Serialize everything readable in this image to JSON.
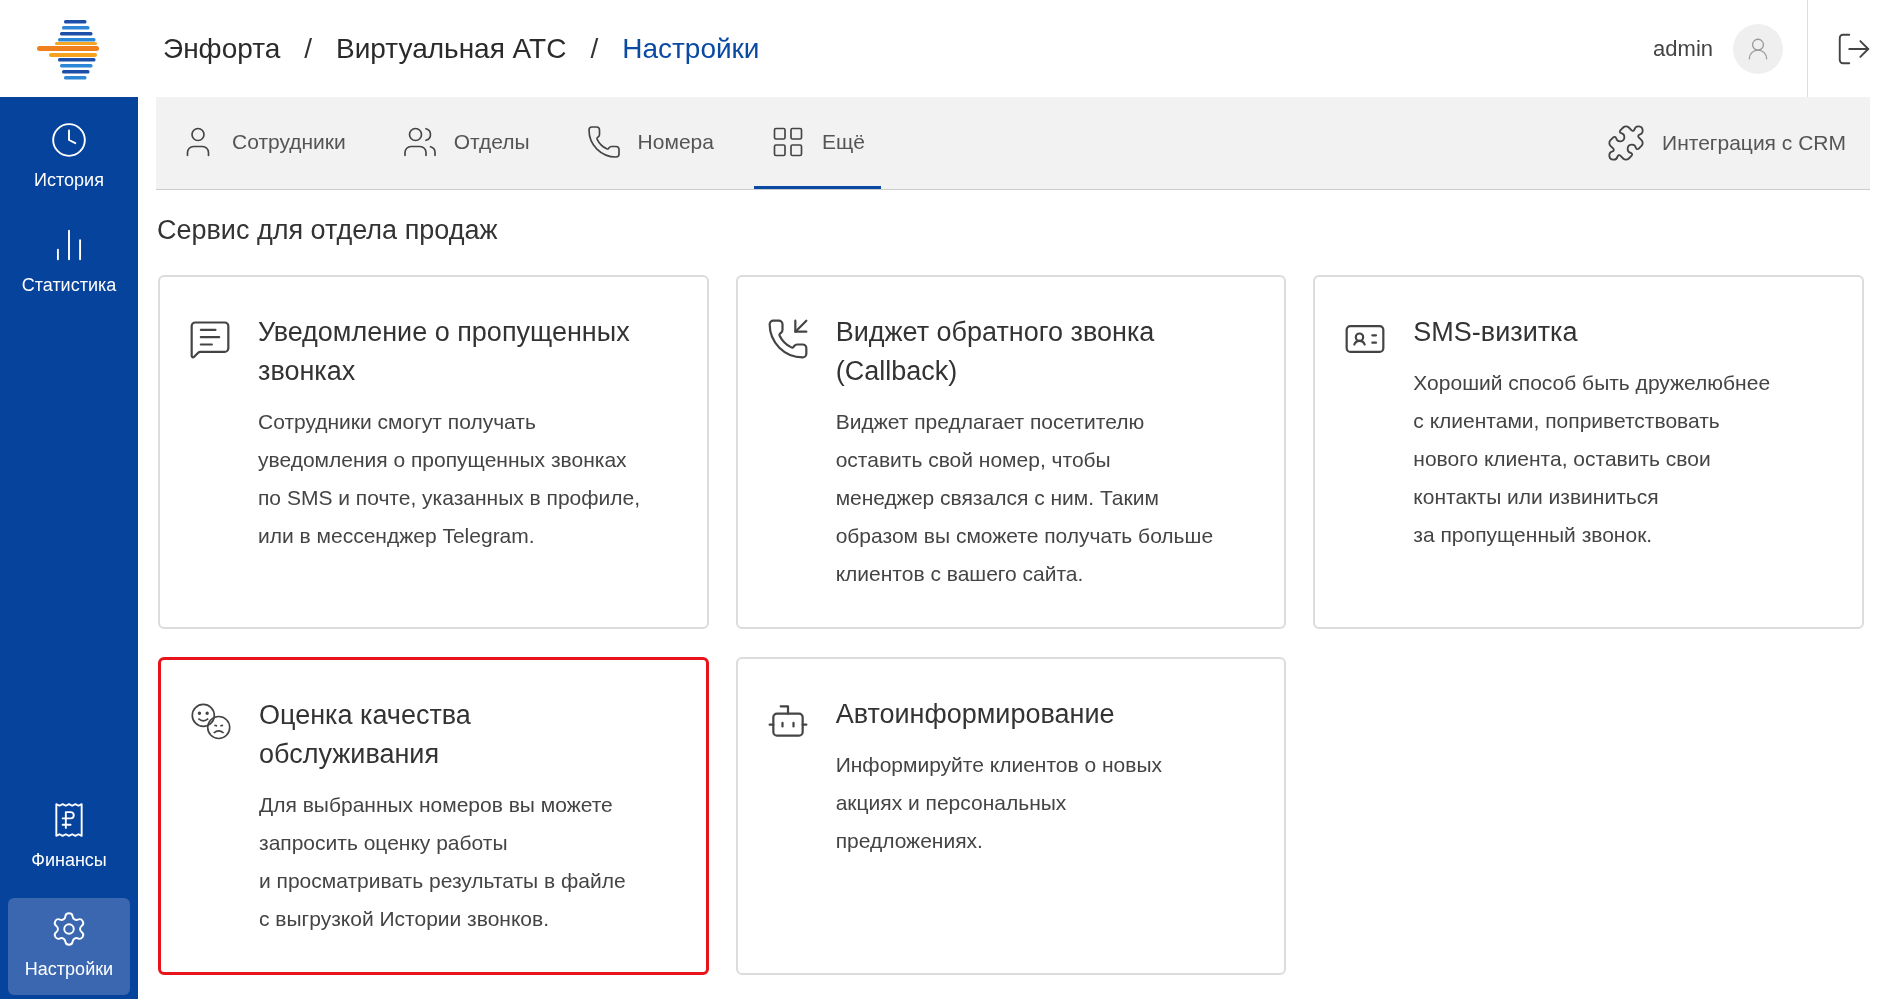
{
  "breadcrumb": [
    {
      "label": "Энфорта",
      "selected": false
    },
    {
      "label": "Виртуальная АТС",
      "selected": false
    },
    {
      "label": "Настройки",
      "selected": true
    }
  ],
  "breadcrumb_separator": "/",
  "user": {
    "name": "admin"
  },
  "sidebar": {
    "items": [
      {
        "kind": "history",
        "label": "История",
        "selected": false
      },
      {
        "kind": "stats",
        "label": "Статистика",
        "selected": false
      }
    ],
    "bottom_items": [
      {
        "kind": "finance",
        "label": "Финансы",
        "selected": false
      },
      {
        "kind": "settings",
        "label": "Настройки",
        "selected": true
      }
    ]
  },
  "tabs": [
    {
      "kind": "employees",
      "label": "Сотрудники",
      "selected": false
    },
    {
      "kind": "departments",
      "label": "Отделы",
      "selected": false
    },
    {
      "kind": "numbers",
      "label": "Номера",
      "selected": false
    },
    {
      "kind": "more",
      "label": "Ещё",
      "selected": true
    }
  ],
  "crm_link": "Интеграция с CRM",
  "section_title": "Сервис для отдела продаж",
  "cards": [
    {
      "kind": "missed",
      "title": "Уведомление о пропущенных\nзвонках",
      "description": "Сотрудники смогут получать\nуведомления о пропущенных звонках\nпо SMS и почте, указанных в профиле,\nили в мессенджер Telegram.",
      "highlighted": false
    },
    {
      "kind": "callback",
      "title": "Виджет обратного звонка\n(Callback)",
      "description": "Виджет предлагает посетителю\nоставить свой номер, чтобы\nменеджер связался с ним. Таким\nобразом вы сможете получать больше\nклиентов с вашего сайта.",
      "highlighted": false
    },
    {
      "kind": "sms",
      "title": "SMS-визитка",
      "description": "Хороший способ быть дружелюбнее\nс клиентами, поприветствовать\nнового клиента, оставить свои\nконтакты или извиниться\nза пропущенный звонок.",
      "highlighted": false
    },
    {
      "kind": "rating",
      "title": "Оценка качества\nобслуживания",
      "description": "Для выбранных номеров вы можете\nзапросить оценку работы\nи просматривать результаты в файле\nс выгрузкой Истории звонков.",
      "highlighted": true
    },
    {
      "kind": "robot",
      "title": "Автоинформирование",
      "description": "Информируйте клиентов о новых\nакциях и персональных\nпредложениях.",
      "highlighted": false
    }
  ]
}
